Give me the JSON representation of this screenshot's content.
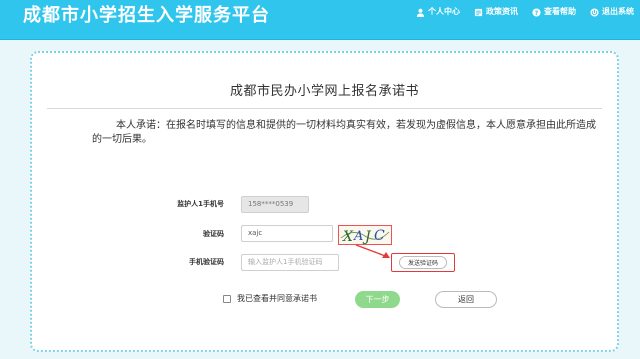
{
  "header": {
    "site_title": "成都市小学招生入学服务平台",
    "nav": [
      {
        "label": "个人中心",
        "icon": "user-icon"
      },
      {
        "label": "政策资讯",
        "icon": "news-icon"
      },
      {
        "label": "查看帮助",
        "icon": "help-icon"
      },
      {
        "label": "退出系统",
        "icon": "logout-icon"
      }
    ]
  },
  "page": {
    "title": "成都市民办小学网上报名承诺书",
    "pledge_text": "本人承诺：在报名时填写的信息和提供的一切材料均真实有效，若发现为虚假信息，本人愿意承担由此所造成的一切后果。"
  },
  "form": {
    "phone_label": "监护人1手机号",
    "phone_value": "158****0539",
    "captcha_label": "验证码",
    "captcha_value": "xajc",
    "captcha_image_text": "XAJC",
    "sms_label": "手机验证码",
    "sms_placeholder": "输入监护人1手机验证码",
    "send_code_label": "发送验证码",
    "agree_label": "我已查看并同意承诺书",
    "next_label": "下一步",
    "back_label": "返回"
  },
  "colors": {
    "header": "#30c5ec",
    "background": "#e9f7fb",
    "next_button": "#8fd98c",
    "highlight_red": "#e23a3a"
  }
}
